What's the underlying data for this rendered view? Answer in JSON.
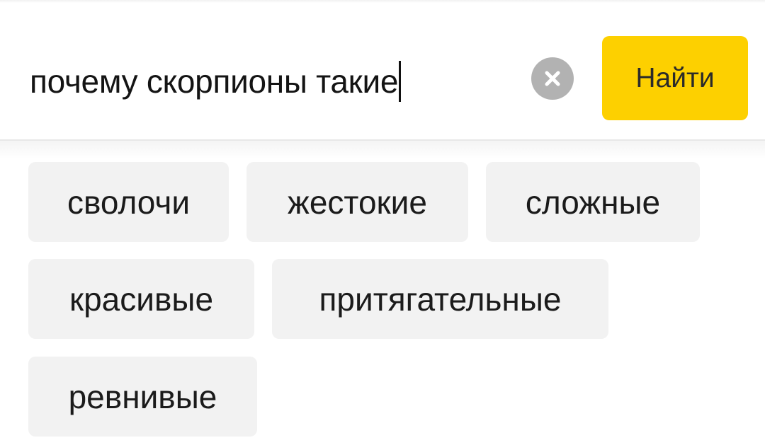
{
  "search": {
    "query": "почему скорпионы такие",
    "clear_icon": "close-icon",
    "find_label": "Найти"
  },
  "colors": {
    "find_button": "#fdd000",
    "clear_button": "#b2b2b2",
    "chip_background": "#f2f2f2"
  },
  "suggestions": [
    "сволочи",
    "жестокие",
    "сложные",
    "красивые",
    "притягательные",
    "ревнивые"
  ]
}
